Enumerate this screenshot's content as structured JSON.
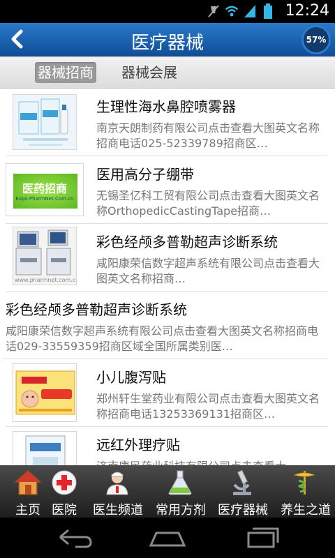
{
  "status_bar": {
    "time": "12:24"
  },
  "header": {
    "back_icon": "chevron-left-icon",
    "title": "医疗器械",
    "badge": "57%"
  },
  "tabs": [
    {
      "label": "器械招商",
      "active": true
    },
    {
      "label": "器械会展",
      "active": false
    }
  ],
  "list": [
    {
      "title": "生理性海水鼻腔喷雾器",
      "desc": "南京天朗制药有限公司点击查看大图英文名称招商电话025-52339789招商区…"
    },
    {
      "title": "医用高分子绷带",
      "thumb_text": "医药招商",
      "thumb_subtext": "Expo.PharmNet.Com.cn",
      "desc": "无锡圣亿科工贸有限公司点击查看大图英文名称OrthopedicCastingTape招商…"
    },
    {
      "title": "彩色经颅多普勒超声诊断系统",
      "thumb_subtext": "www.pharmnet.com.cn",
      "desc": "咸阳康荣信数字超声系统有限公司点击查看大图英文名称招商…"
    },
    {
      "title": "彩色经颅多普勒超声诊断系统",
      "desc": "咸阳康荣信数字超声系统有限公司点击查看大图英文名称招商电话029-33559359招商区域全国所属类别医…"
    },
    {
      "title": "小儿腹泻贴",
      "desc": "郑州轩生堂药业有限公司点击查看大图英文名称招商电话13253369131招商区…"
    },
    {
      "title": "远红外理疗贴",
      "desc": "济南康民药业科技有限公司点击查看大"
    }
  ],
  "bottom_nav": [
    {
      "label": "主页",
      "icon": "house-icon"
    },
    {
      "label": "医院",
      "icon": "red-cross-icon"
    },
    {
      "label": "医生频道",
      "icon": "doctor-icon"
    },
    {
      "label": "常用方剂",
      "icon": "flask-icon"
    },
    {
      "label": "医疗器械",
      "icon": "microscope-icon"
    },
    {
      "label": "养生之道",
      "icon": "caduceus-icon"
    }
  ],
  "colors": {
    "header": "#1a62b0",
    "tab_active": "#9a9a9a",
    "nav_bg": "#2a2a2a"
  }
}
